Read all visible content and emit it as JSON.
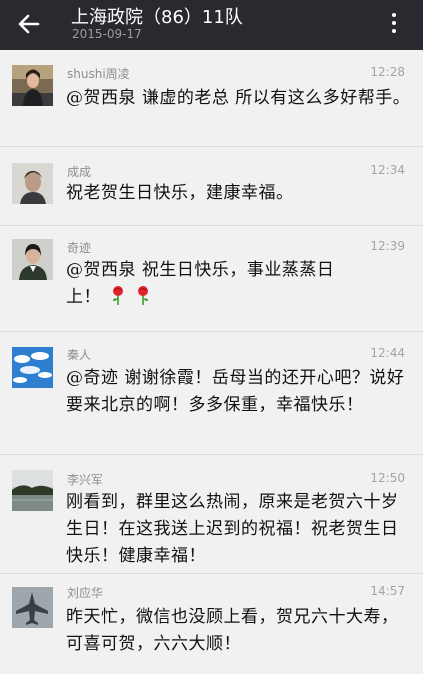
{
  "header": {
    "title": "上海政院（86）11队",
    "date": "2015-09-17",
    "back_icon": "arrow-left-icon",
    "menu_icon": "more-vertical-icon"
  },
  "messages": [
    {
      "name": "shushi周凌",
      "time": "12:28",
      "text": "@贺西泉 谦虚的老总 所以有这么多好帮手。",
      "avatar_icon": "woman-portrait-avatar"
    },
    {
      "name": "成成",
      "time": "12:34",
      "text": "祝老贺生日快乐，建康幸福。",
      "avatar_icon": "man-portrait-avatar"
    },
    {
      "name": "奇迹",
      "time": "12:39",
      "text": "@贺西泉 祝生日快乐，事业蒸蒸日上！",
      "emoji": [
        "rose-icon",
        "rose-icon"
      ],
      "avatar_icon": "woman-uniform-avatar"
    },
    {
      "name": "秦人",
      "time": "12:44",
      "text": "@奇迹 谢谢徐霞！岳母当的还开心吧？说好要来北京的啊！多多保重，幸福快乐！",
      "avatar_icon": "blue-sky-clouds-avatar"
    },
    {
      "name": "李兴军",
      "time": "12:50",
      "text": "刚看到，群里这么热闹，原来是老贺六十岁生日！在这我送上迟到的祝福！祝老贺生日快乐！健康幸福！",
      "avatar_icon": "landscape-lake-avatar"
    },
    {
      "name": "刘应华",
      "time": "14:57",
      "text": "昨天忙，微信也没顾上看，贺兄六十大寿，可喜可贺，六六大顺！",
      "avatar_icon": "fighter-jet-avatar"
    }
  ]
}
